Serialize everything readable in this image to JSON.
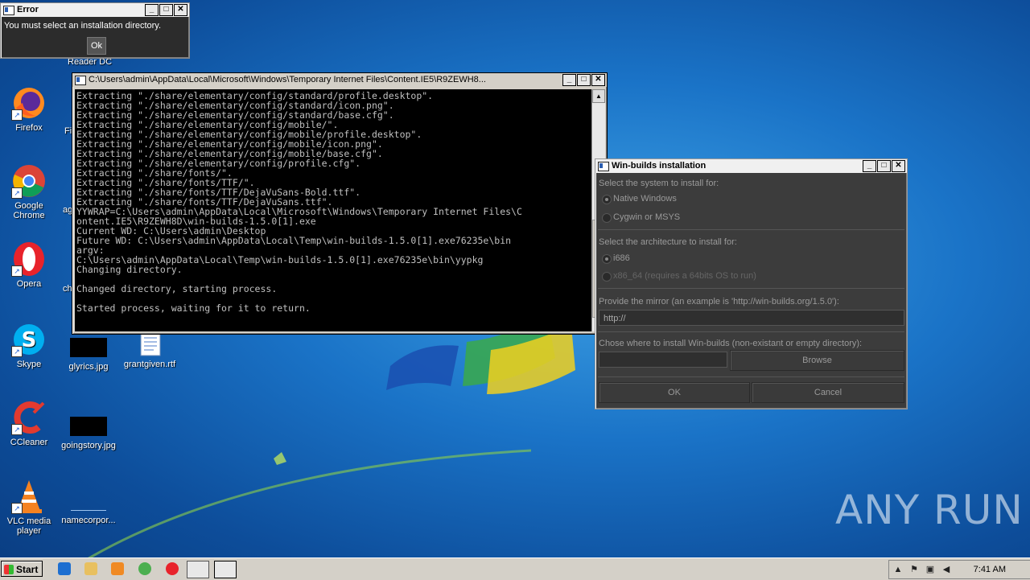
{
  "error_dialog": {
    "title": "Error",
    "message": "You must select an installation directory.",
    "ok_label": "Ok"
  },
  "desktop": {
    "partial_label_reader": "Reader DC",
    "icons": [
      {
        "label": "Firefox"
      },
      {
        "label": "Google Chrome"
      },
      {
        "label": "Opera"
      },
      {
        "label": "Skype"
      },
      {
        "label": "CCleaner"
      },
      {
        "label": "VLC media player"
      },
      {
        "label": "glyrics.jpg"
      },
      {
        "label": "grantgiven.rtf"
      },
      {
        "label": "goingstory.jpg"
      },
      {
        "label": "namecorpor..."
      }
    ],
    "partial_labels": [
      "Fi",
      "ag",
      "ch"
    ],
    "watermark": "ANY RUN"
  },
  "console": {
    "title": "C:\\Users\\admin\\AppData\\Local\\Microsoft\\Windows\\Temporary Internet Files\\Content.IE5\\R9ZEWH8...",
    "lines": "Extracting \"./share/elementary/config/standard/profile.desktop\".\nExtracting \"./share/elementary/config/standard/icon.png\".\nExtracting \"./share/elementary/config/standard/base.cfg\".\nExtracting \"./share/elementary/config/mobile/\".\nExtracting \"./share/elementary/config/mobile/profile.desktop\".\nExtracting \"./share/elementary/config/mobile/icon.png\".\nExtracting \"./share/elementary/config/mobile/base.cfg\".\nExtracting \"./share/elementary/config/profile.cfg\".\nExtracting \"./share/fonts/\".\nExtracting \"./share/fonts/TTF/\".\nExtracting \"./share/fonts/TTF/DejaVuSans-Bold.ttf\".\nExtracting \"./share/fonts/TTF/DejaVuSans.ttf\".\nYYWRAP=C:\\Users\\admin\\AppData\\Local\\Microsoft\\Windows\\Temporary Internet Files\\C\nontent.IE5\\R9ZEWH8D\\win-builds-1.5.0[1].exe\nCurrent WD: C:\\Users\\admin\\Desktop\nFuture WD: C:\\Users\\admin\\AppData\\Local\\Temp\\win-builds-1.5.0[1].exe76235e\\bin\nargv:\nC:\\Users\\admin\\AppData\\Local\\Temp\\win-builds-1.5.0[1].exe76235e\\bin\\yypkg\nChanging directory.\n\nChanged directory, starting process.\n\nStarted process, waiting for it to return."
  },
  "winbuilds": {
    "title": "Win-builds installation",
    "system_label": "Select the system to install for:",
    "system_options": [
      "Native Windows",
      "Cygwin or MSYS"
    ],
    "arch_label": "Select the architecture to install for:",
    "arch_options": [
      "i686",
      "x86_64 (requires a 64bits OS to run)"
    ],
    "mirror_label": "Provide the mirror (an example is 'http://win-builds.org/1.5.0'):",
    "mirror_value": "http://",
    "dir_label": "Chose where to install Win-builds (non-existant or empty directory):",
    "dir_value": "",
    "browse_label": "Browse",
    "ok_label": "OK",
    "cancel_label": "Cancel"
  },
  "taskbar": {
    "start_label": "Start",
    "clock": "7:41 AM"
  }
}
